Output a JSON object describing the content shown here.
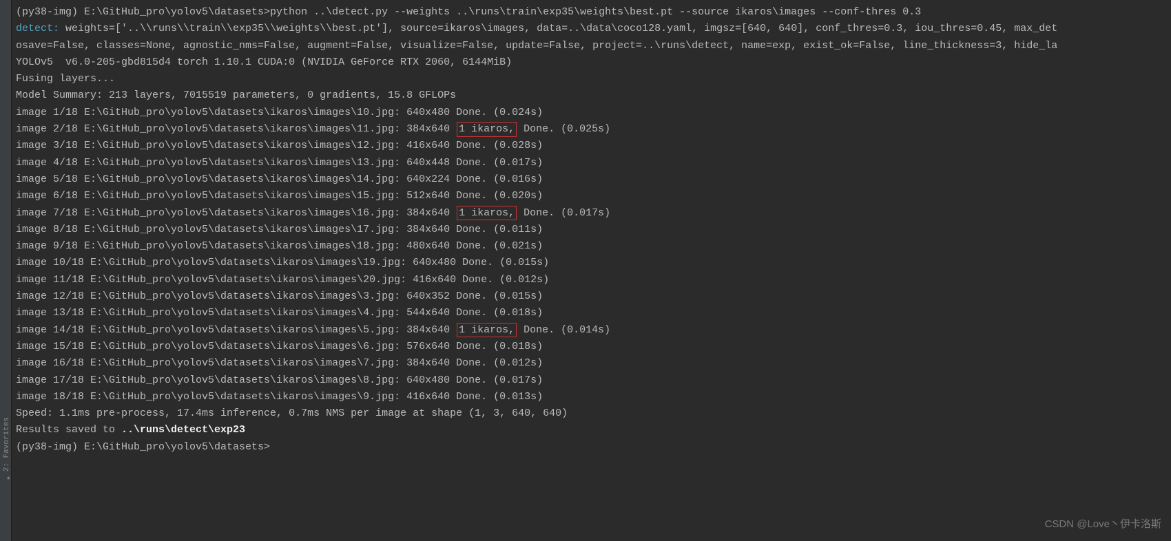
{
  "sidebar": {
    "tab_label": "2: Favorites"
  },
  "terminal": {
    "line1": "(py38-img) E:\\GitHub_pro\\yolov5\\datasets>python ..\\detect.py --weights ..\\runs\\train\\exp35\\weights\\best.pt --source ikaros\\images --conf-thres 0.3",
    "line2_label": "detect:",
    "line2_rest": " weights=['..\\\\runs\\\\train\\\\exp35\\\\weights\\\\best.pt'], source=ikaros\\images, data=..\\data\\coco128.yaml, imgsz=[640, 640], conf_thres=0.3, iou_thres=0.45, max_det",
    "line3": "osave=False, classes=None, agnostic_nms=False, augment=False, visualize=False, update=False, project=..\\runs\\detect, name=exp, exist_ok=False, line_thickness=3, hide_la",
    "line4": "YOLOv5  v6.0-205-gbd815d4 torch 1.10.1 CUDA:0 (NVIDIA GeForce RTX 2060, 6144MiB)",
    "blank1": "",
    "line5": "Fusing layers...",
    "line6": "Model Summary: 213 layers, 7015519 parameters, 0 gradients, 15.8 GFLOPs",
    "images": [
      {
        "pre": "image 1/18 E:\\GitHub_pro\\yolov5\\datasets\\ikaros\\images\\10.jpg: 640x480 Done. (0.024s)",
        "hl": null,
        "post": null
      },
      {
        "pre": "image 2/18 E:\\GitHub_pro\\yolov5\\datasets\\ikaros\\images\\11.jpg: 384x640 ",
        "hl": "1 ikaros,",
        "post": " Done. (0.025s)"
      },
      {
        "pre": "image 3/18 E:\\GitHub_pro\\yolov5\\datasets\\ikaros\\images\\12.jpg: 416x640 Done. (0.028s)",
        "hl": null,
        "post": null
      },
      {
        "pre": "image 4/18 E:\\GitHub_pro\\yolov5\\datasets\\ikaros\\images\\13.jpg: 640x448 Done. (0.017s)",
        "hl": null,
        "post": null
      },
      {
        "pre": "image 5/18 E:\\GitHub_pro\\yolov5\\datasets\\ikaros\\images\\14.jpg: 640x224 Done. (0.016s)",
        "hl": null,
        "post": null
      },
      {
        "pre": "image 6/18 E:\\GitHub_pro\\yolov5\\datasets\\ikaros\\images\\15.jpg: 512x640 Done. (0.020s)",
        "hl": null,
        "post": null
      },
      {
        "pre": "image 7/18 E:\\GitHub_pro\\yolov5\\datasets\\ikaros\\images\\16.jpg: 384x640 ",
        "hl": "1 ikaros,",
        "post": " Done. (0.017s)"
      },
      {
        "pre": "image 8/18 E:\\GitHub_pro\\yolov5\\datasets\\ikaros\\images\\17.jpg: 384x640 Done. (0.011s)",
        "hl": null,
        "post": null
      },
      {
        "pre": "image 9/18 E:\\GitHub_pro\\yolov5\\datasets\\ikaros\\images\\18.jpg: 480x640 Done. (0.021s)",
        "hl": null,
        "post": null
      },
      {
        "pre": "image 10/18 E:\\GitHub_pro\\yolov5\\datasets\\ikaros\\images\\19.jpg: 640x480 Done. (0.015s)",
        "hl": null,
        "post": null
      },
      {
        "pre": "image 11/18 E:\\GitHub_pro\\yolov5\\datasets\\ikaros\\images\\20.jpg: 416x640 Done. (0.012s)",
        "hl": null,
        "post": null
      },
      {
        "pre": "image 12/18 E:\\GitHub_pro\\yolov5\\datasets\\ikaros\\images\\3.jpg: 640x352 Done. (0.015s)",
        "hl": null,
        "post": null
      },
      {
        "pre": "image 13/18 E:\\GitHub_pro\\yolov5\\datasets\\ikaros\\images\\4.jpg: 544x640 Done. (0.018s)",
        "hl": null,
        "post": null
      },
      {
        "pre": "image 14/18 E:\\GitHub_pro\\yolov5\\datasets\\ikaros\\images\\5.jpg: 384x640 ",
        "hl": "1 ikaros,",
        "post": " Done. (0.014s)"
      },
      {
        "pre": "image 15/18 E:\\GitHub_pro\\yolov5\\datasets\\ikaros\\images\\6.jpg: 576x640 Done. (0.018s)",
        "hl": null,
        "post": null
      },
      {
        "pre": "image 16/18 E:\\GitHub_pro\\yolov5\\datasets\\ikaros\\images\\7.jpg: 384x640 Done. (0.012s)",
        "hl": null,
        "post": null
      },
      {
        "pre": "image 17/18 E:\\GitHub_pro\\yolov5\\datasets\\ikaros\\images\\8.jpg: 640x480 Done. (0.017s)",
        "hl": null,
        "post": null
      },
      {
        "pre": "image 18/18 E:\\GitHub_pro\\yolov5\\datasets\\ikaros\\images\\9.jpg: 416x640 Done. (0.013s)",
        "hl": null,
        "post": null
      }
    ],
    "speed": "Speed: 1.1ms pre-process, 17.4ms inference, 0.7ms NMS per image at shape (1, 3, 640, 640)",
    "results_label": "Results saved to ",
    "results_path": "..\\runs\\detect\\exp23",
    "blank2": "",
    "prompt2": "(py38-img) E:\\GitHub_pro\\yolov5\\datasets>"
  },
  "watermark": "CSDN @Love丶伊卡洛斯"
}
